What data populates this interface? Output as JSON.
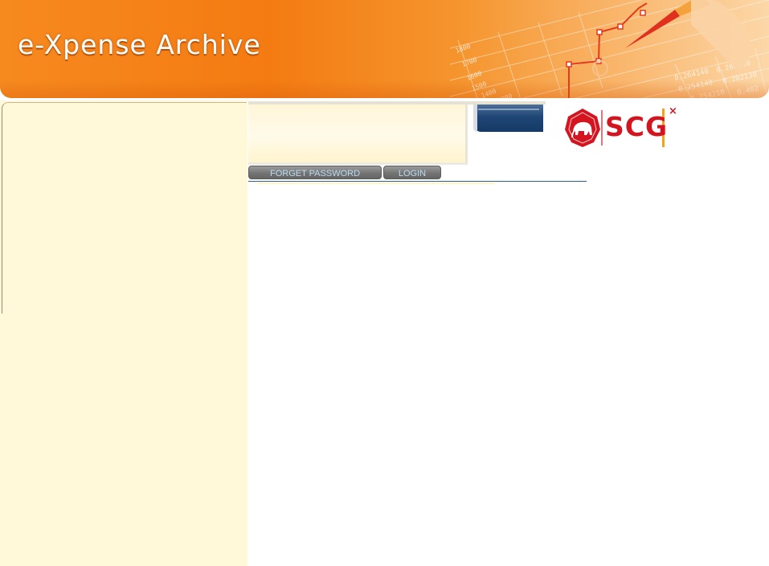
{
  "header": {
    "title": "e-Xpense Archive"
  },
  "login": {
    "forget_password_label": "FORGET PASSWORD",
    "login_label": "LOGIN"
  },
  "logo": {
    "text": "SCG",
    "close_glyph": "×",
    "icon": "elephant-seal-icon"
  },
  "decoration": {
    "axis_labels": [
      "1800",
      "1700",
      "1600",
      "1500",
      "1400",
      "1300"
    ],
    "table_values": [
      "0.264140",
      "0.202130",
      "0.254140",
      "0.202130",
      "0.254210",
      "0.402"
    ]
  },
  "colors": {
    "brand_orange": "#f47b12",
    "brand_red": "#d4151f",
    "panel_yellow": "#fff8d9",
    "button_text": "#b9dcf2"
  }
}
